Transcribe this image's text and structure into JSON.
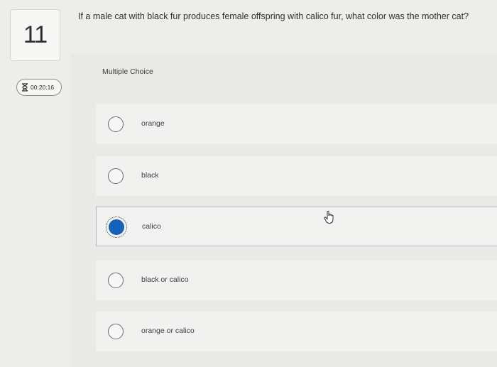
{
  "question": {
    "number": "11",
    "text": "If a male cat with black fur produces female offspring with calico fur, what color was the mother cat?",
    "type_label": "Multiple Choice"
  },
  "timer": {
    "icon": "hourglass-icon",
    "value": "00:20:16"
  },
  "options": [
    {
      "label": "orange",
      "selected": false
    },
    {
      "label": "black",
      "selected": false
    },
    {
      "label": "calico",
      "selected": true
    },
    {
      "label": "black or calico",
      "selected": false
    },
    {
      "label": "orange or calico",
      "selected": false
    }
  ],
  "colors": {
    "selected_radio": "#1560b8",
    "selected_border": "#a9b7c6",
    "background": "#edeeea"
  }
}
